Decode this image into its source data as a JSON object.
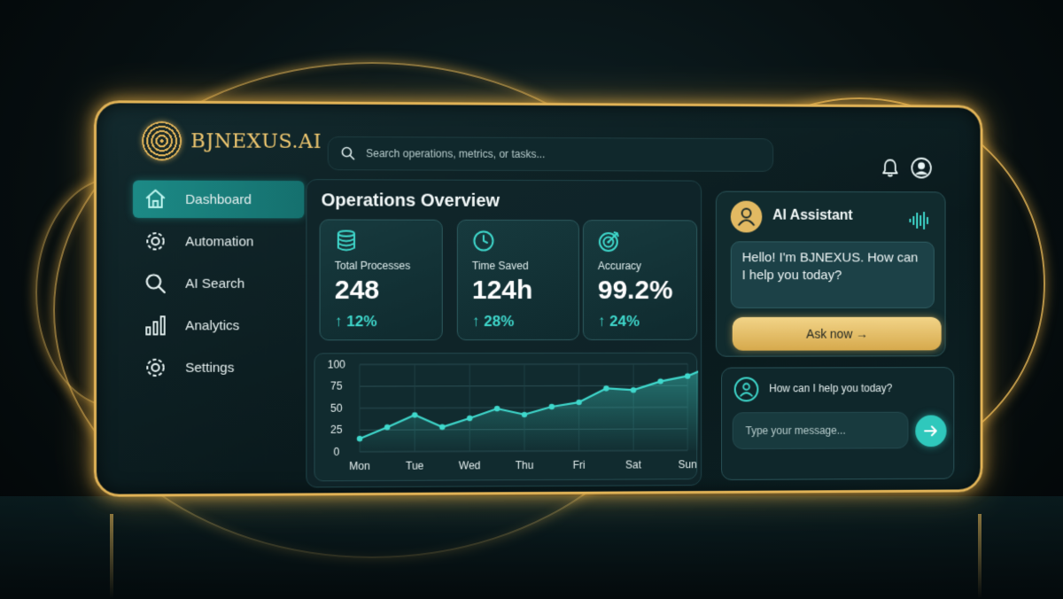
{
  "brand": {
    "name": "BJNEXUS.AI",
    "accent": "#3fd8cc",
    "gold": "#e4b65a"
  },
  "search": {
    "placeholder": "Search operations, metrics, or tasks..."
  },
  "header": {
    "icons": [
      "bell-icon",
      "user-icon"
    ]
  },
  "sidebar": {
    "items": [
      {
        "label": "Dashboard",
        "icon": "home-icon",
        "active": true
      },
      {
        "label": "Automation",
        "icon": "gear-icon",
        "active": false
      },
      {
        "label": "AI Search",
        "icon": "search-icon",
        "active": false
      },
      {
        "label": "Analytics",
        "icon": "bar-chart-icon",
        "active": false
      },
      {
        "label": "Settings",
        "icon": "gear-icon",
        "active": false
      }
    ]
  },
  "overview": {
    "title": "Operations Overview",
    "kpis": [
      {
        "label": "Total Processes",
        "value": "248",
        "change": "↑ 12%",
        "icon": "database-icon"
      },
      {
        "label": "Time Saved",
        "value": "124h",
        "change": "↑ 28%",
        "icon": "clock-icon"
      },
      {
        "label": "Accuracy",
        "value": "99.2%",
        "change": "↑ 24%",
        "icon": "target-icon"
      }
    ]
  },
  "chart_data": {
    "type": "line",
    "categories": [
      "Mon",
      "Tue",
      "Wed",
      "Thu",
      "Fri",
      "Sat",
      "Sun"
    ],
    "x": [
      0,
      0.5,
      1,
      1.5,
      2,
      2.5,
      3,
      3.5,
      4,
      4.5,
      5,
      5.5,
      6,
      6.5
    ],
    "values": [
      15,
      28,
      42,
      28,
      38,
      49,
      42,
      51,
      56,
      72,
      70,
      80,
      86,
      99
    ],
    "ylim": [
      0,
      100
    ],
    "yticks": [
      0,
      25,
      50,
      75,
      100
    ],
    "title": "",
    "xlabel": "",
    "ylabel": "",
    "grid": true,
    "color": "#3fd8cc"
  },
  "assistant": {
    "title": "AI Assistant",
    "greeting": "Hello! I'm BJNEXUS. How can I help you today?",
    "cta": "Ask now →"
  },
  "chat": {
    "question": "How can I help you today?",
    "placeholder": "Type your message..."
  }
}
